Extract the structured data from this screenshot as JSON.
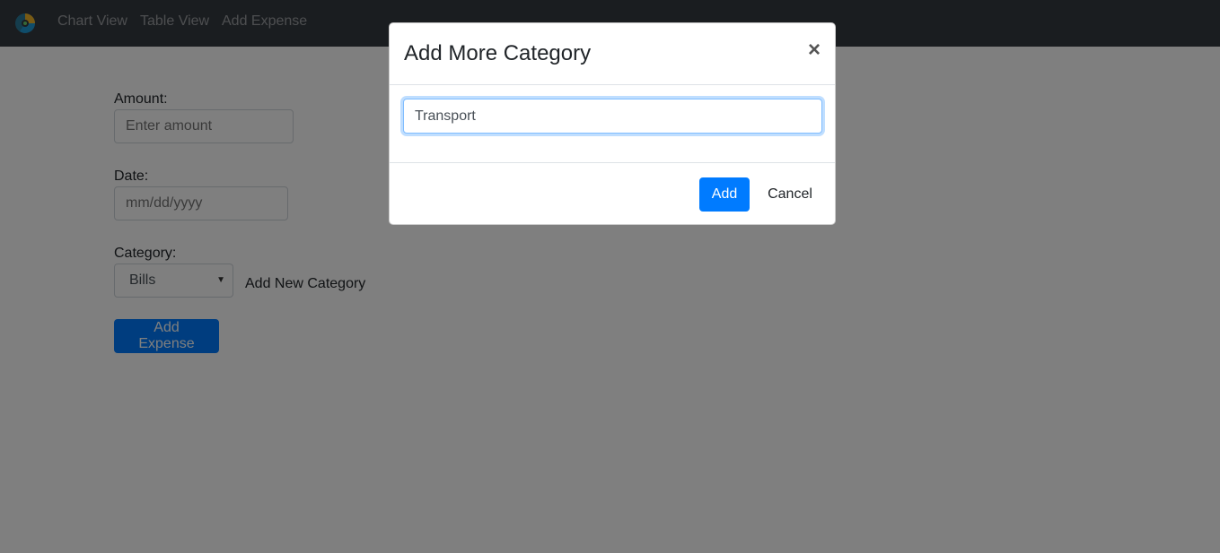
{
  "navbar": {
    "logo_icon": "app-logo-icon",
    "links": [
      "Chart View",
      "Table View",
      "Add Expense"
    ]
  },
  "form": {
    "amount_label": "Amount:",
    "amount_placeholder": "Enter amount",
    "date_label": "Date:",
    "date_placeholder": "mm/dd/yyyy",
    "category_label": "Category:",
    "category_selected": "Bills",
    "add_category_link": "Add New Category",
    "submit_label": "Add Expense"
  },
  "modal": {
    "title": "Add More Category",
    "close_symbol": "×",
    "input_value": "Transport",
    "add_label": "Add",
    "cancel_label": "Cancel"
  },
  "colors": {
    "navbar_bg": "#343a40",
    "primary": "#007bff",
    "backdrop": "rgba(0,0,0,0.5)"
  }
}
